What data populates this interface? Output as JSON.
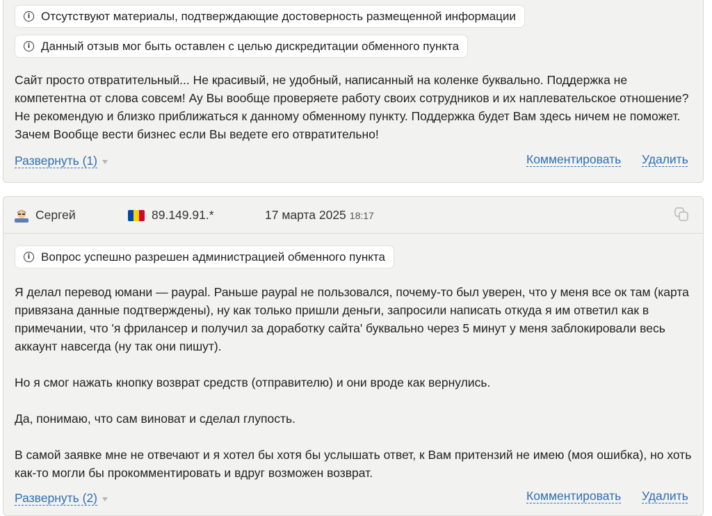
{
  "review1": {
    "badges": [
      "Отсутствуют материалы, подтверждающие достоверность размещенной информации",
      "Данный отзыв мог быть оставлен с целью дискредитации обменного пункта"
    ],
    "paragraphs": [
      "Сайт просто отвратительный... Не красивый, не удобный, написанный на коленке буквально. Поддержка не компетентна от слова совсем! Ау Вы вообще проверяете работу своих сотрудников и их наплевательское отношение? Не рекомендую и близко приближаться к данному обменному пункту. Поддержка будет Вам здесь ничем не поможет. Зачем Вообще вести бизнес если Вы ведете его отвратительно!"
    ],
    "expand_label": "Развернуть (1)",
    "comment_label": "Комментировать",
    "delete_label": "Удалить"
  },
  "review2": {
    "author": "Сергей",
    "ip": "89.149.91.*",
    "date": "17 марта 2025",
    "time": "18:17",
    "badges": [
      "Вопрос успешно разрешен администрацией обменного пункта"
    ],
    "paragraphs": [
      "Я делал перевод юмани — paypal. Раньше paypal не пользовался, почему-то был уверен, что у меня все ок там (карта привязана данные подтверждены), ну как только пришли деньги, запросили написать откуда я им ответил как в примечании, что 'я фрилансер и получил за доработку сайта' буквально через 5 минут у меня заблокировали весь аккаунт навсегда (ну так они пишут).",
      "Но я смог нажать кнопку возврат средств (отправителю) и они вроде как вернулись.",
      "Да, понимаю, что сам виноват и сделал глупость.",
      "В самой заявке мне не отвечают и я хотел бы хотя бы услышать ответ, к Вам притензий не имею (моя ошибка), но хоть как-то могли бы прокомментировать и вдруг возможен возврат."
    ],
    "expand_label": "Развернуть (2)",
    "comment_label": "Комментировать",
    "delete_label": "Удалить"
  },
  "icons": {
    "info": "info-icon",
    "avatar": "user-avatar-icon",
    "flag": "moldova-flag-icon",
    "copy": "copy-icon",
    "expand": "triangle-down-icon"
  },
  "colors": {
    "card_bg": "#f2f2f0",
    "link": "#2f6fb3",
    "flag": [
      "#0046ae",
      "#ffd200",
      "#cc092f"
    ]
  }
}
